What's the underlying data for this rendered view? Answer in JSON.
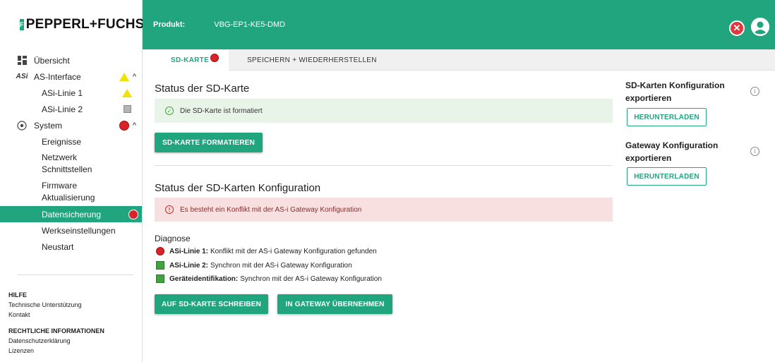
{
  "brand": {
    "logo_text": "PEPPERL+FUCHS",
    "accent": "#21a57e"
  },
  "sidebar": {
    "items": [
      {
        "label": "Übersicht"
      },
      {
        "label": "AS-Interface"
      },
      {
        "label": "ASi-Linie 1"
      },
      {
        "label": "ASi-Linie 2"
      },
      {
        "label": "System"
      },
      {
        "label": "Ereignisse"
      },
      {
        "label": "Netzwerk Schnittstellen"
      },
      {
        "label": "Firmware Aktualisierung"
      },
      {
        "label": "Datensicherung"
      },
      {
        "label": "Werkseinstellungen"
      },
      {
        "label": "Neustart"
      }
    ],
    "footer": {
      "help_heading": "HILFE",
      "support": "Technische Unterstützung",
      "contact": "Kontakt",
      "legal_heading": "RECHTLICHE INFORMATIONEN",
      "privacy": "Datenschutzerklärung",
      "licenses": "Lizenzen"
    }
  },
  "header": {
    "product_label": "Produkt:",
    "product_value": "VBG-EP1-KE5-DMD"
  },
  "tabs": [
    {
      "label": "SD-KARTE"
    },
    {
      "label": "SPEICHERN + WIEDERHERSTELLEN"
    }
  ],
  "main": {
    "sd_status_title": "Status der SD-Karte",
    "sd_status_msg": "Die SD-Karte ist formatiert",
    "format_button": "SD-KARTE FORMATIEREN",
    "config_title": "Status der SD-Karten Konfiguration",
    "config_msg": "Es besteht ein Konflikt mit der AS-i Gateway Konfiguration",
    "diag_title": "Diagnose",
    "diag": [
      {
        "name": "ASi-Linie 1:",
        "text": "Konflikt mit der AS-i Gateway Konfiguration gefunden",
        "status": "red"
      },
      {
        "name": "ASi-Linie 2:",
        "text": "Synchron mit der AS-i Gateway Konfiguration",
        "status": "green"
      },
      {
        "name": "Geräteidentifikation:",
        "text": "Synchron mit der AS-i Gateway Konfiguration",
        "status": "green"
      }
    ],
    "write_button": "AUF SD-KARTE SCHREIBEN",
    "apply_button": "IN GATEWAY ÜBERNEHMEN"
  },
  "side": {
    "sd_export_title": "SD-Karten Konfiguration exportieren",
    "sd_export_button": "HERUNTERLADEN",
    "gw_export_title": "Gateway Konfiguration exportieren",
    "gw_export_button": "HERUNTERLADEN"
  }
}
